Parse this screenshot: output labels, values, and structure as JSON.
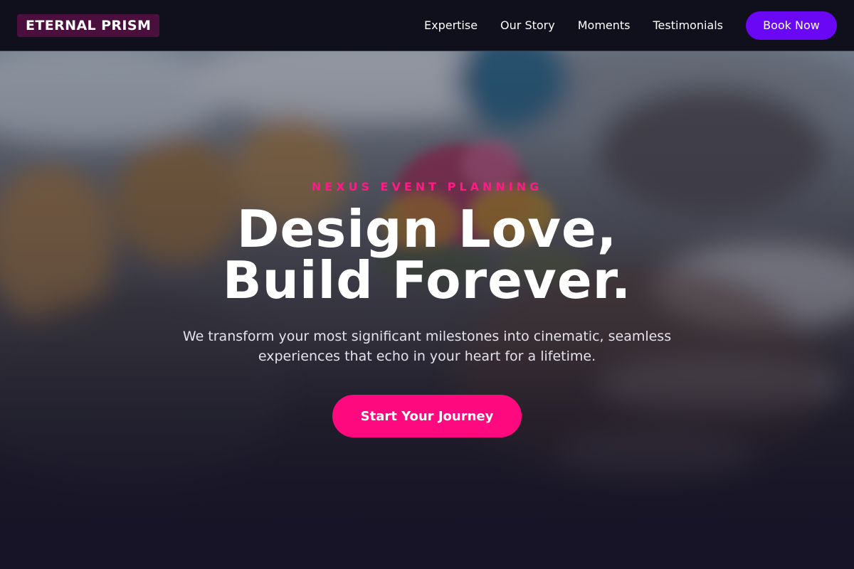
{
  "nav": {
    "logo": "ETERNAL PRISM",
    "links": [
      "Expertise",
      "Our Story",
      "Moments",
      "Testimonials"
    ],
    "cta": "Book Now"
  },
  "hero": {
    "eyebrow": "NEXUS EVENT PLANNING",
    "headline_line1": "Design Love,",
    "headline_line2": "Build Forever.",
    "subtext": "We transform your most significant milestones into cinematic, seamless experiences that echo in your heart for a lifetime.",
    "cta": "Start Your Journey"
  },
  "colors": {
    "nav_bg": "#100f1c",
    "logo_bg": "#4a0f3c",
    "book_button": "#6a08f5",
    "accent_pink": "#ff0a7e"
  }
}
